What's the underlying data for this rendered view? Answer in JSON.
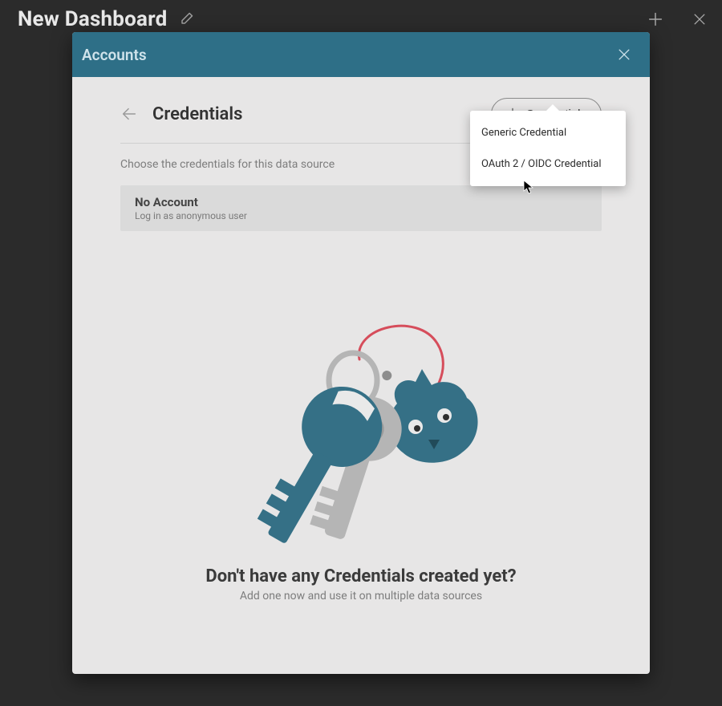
{
  "page": {
    "title": "New Dashboard"
  },
  "modal": {
    "title": "Accounts",
    "heading": "Credentials",
    "add_button_label": "Credentials",
    "instruction": "Choose the credentials for this data source",
    "account": {
      "title": "No Account",
      "subtitle": "Log in as anonymous user"
    },
    "dropdown": {
      "items": {
        "0": "Generic Credential",
        "1": "OAuth 2 / OIDC Credential"
      }
    },
    "empty": {
      "heading": "Don't have any Credentials created yet?",
      "subtitle": "Add one now and use it on multiple data sources"
    }
  }
}
